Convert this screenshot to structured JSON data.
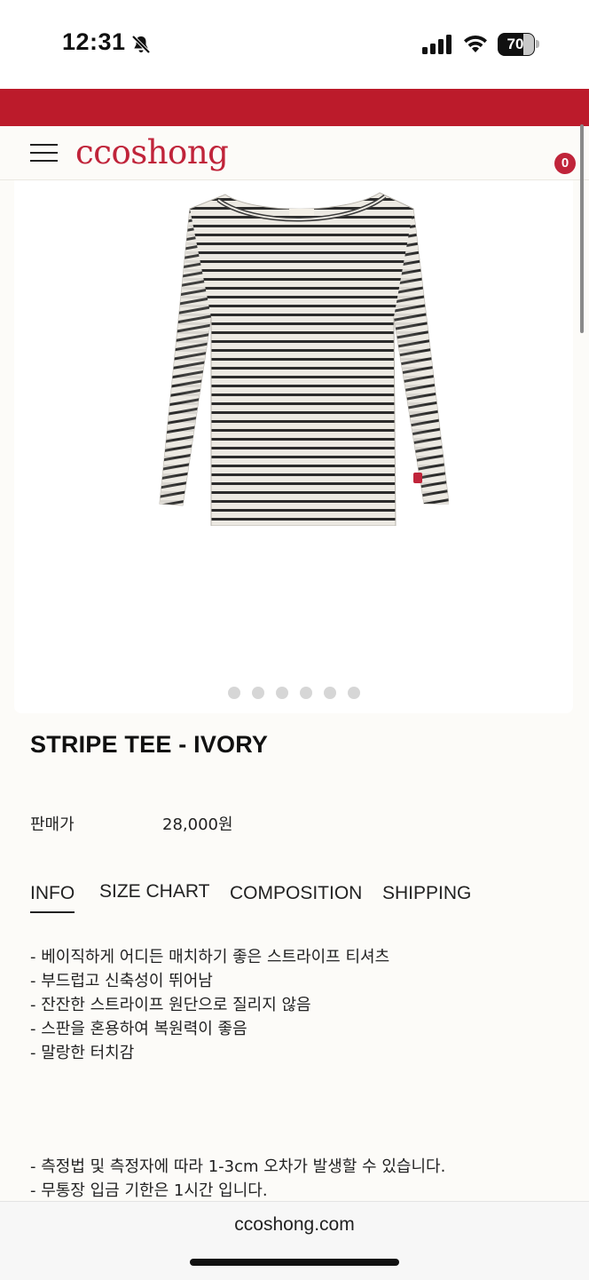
{
  "status_bar": {
    "time": "12:31",
    "battery_level": "70",
    "battery_fraction": 0.7,
    "icons": [
      "bell-slash-icon",
      "cellular-signal-icon",
      "wifi-icon",
      "battery-icon"
    ]
  },
  "colors": {
    "brand": "#c0243a",
    "banner": "#bc1b2b",
    "page_background": "#fcfbf8"
  },
  "header": {
    "logo": "ccoshong",
    "cart_count": "0",
    "icons": [
      "hamburger-menu-icon"
    ]
  },
  "product": {
    "image_description_icon": "striped-long-sleeve-tee-image",
    "carousel": {
      "total_slides": 6
    },
    "title": "STRIPE TEE - IVORY",
    "price_label": "판매가",
    "price": "28,000원"
  },
  "tabs": [
    {
      "label": "INFO",
      "active": true
    },
    {
      "label": "SIZE CHART",
      "active": false
    },
    {
      "label": "COMPOSITION",
      "active": false
    },
    {
      "label": "SHIPPING",
      "active": false
    }
  ],
  "description": [
    "- 베이직하게 어디든 매치하기 좋은 스트라이프 티셔츠",
    "- 부드럽고 신축성이 뛰어남",
    "- 잔잔한 스트라이프 원단으로 질리지 않음",
    "- 스판을 혼용하여 복원력이 좋음",
    "- 말랑한 터치감"
  ],
  "notes": [
    "- 측정법 및 측정자에 따라 1-3cm 오차가 발생할 수 있습니다.",
    "- 무통장 입금 기한은 1시간 입니다."
  ],
  "browser": {
    "url": "ccoshong.com"
  }
}
